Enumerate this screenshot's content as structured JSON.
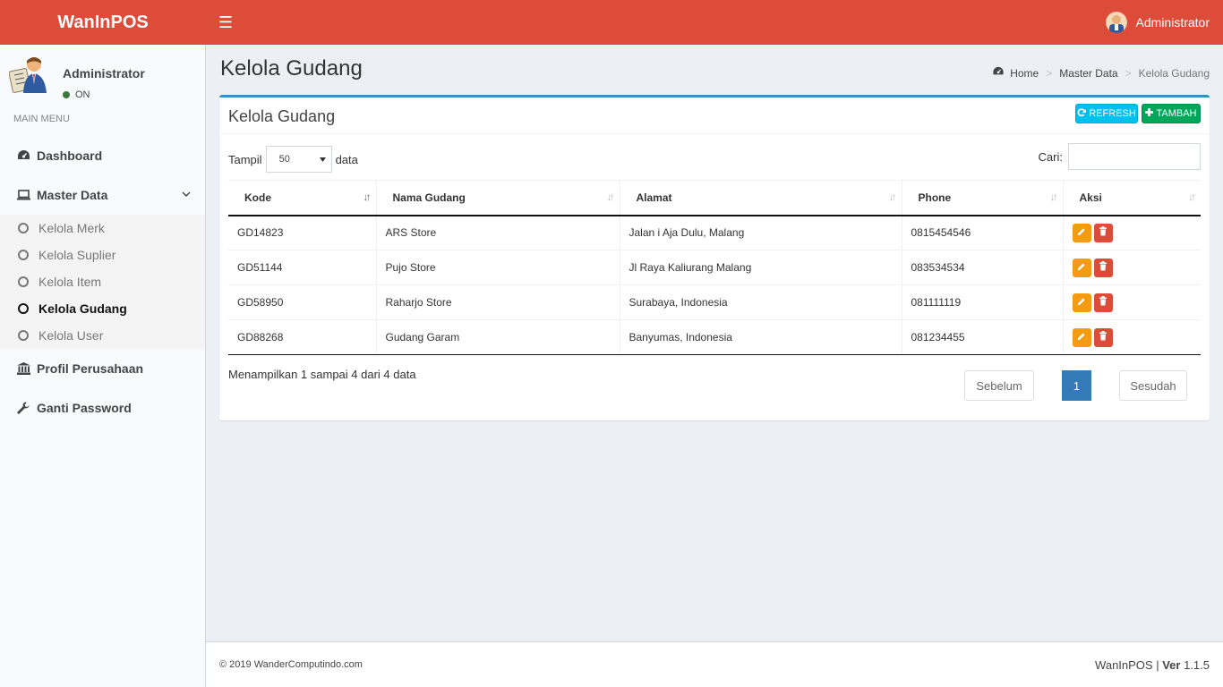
{
  "app": {
    "logo": "WanInPOS"
  },
  "topbar": {
    "menu_icon": "hamburger-icon",
    "user_name": "Administrator"
  },
  "sidebar": {
    "user_name": "Administrator",
    "user_status": "ON",
    "menu_header": "MAIN MENU",
    "items": [
      {
        "label": "Dashboard",
        "icon": "dashboard-icon"
      },
      {
        "label": "Master Data",
        "icon": "laptop-icon"
      },
      {
        "label": "Profil Perusahaan",
        "icon": "bank-icon"
      },
      {
        "label": "Ganti Password",
        "icon": "wrench-icon"
      }
    ],
    "submenu": [
      {
        "label": "Kelola Merk"
      },
      {
        "label": "Kelola Suplier"
      },
      {
        "label": "Kelola Item"
      },
      {
        "label": "Kelola Gudang"
      },
      {
        "label": "Kelola User"
      }
    ]
  },
  "page": {
    "title": "Kelola Gudang",
    "breadcrumb": {
      "home": "Home",
      "section": "Master Data",
      "current": "Kelola Gudang"
    }
  },
  "box": {
    "title": "Kelola Gudang",
    "refresh_label": "REFRESH",
    "add_label": "TAMBAH",
    "show_prefix": "Tampil",
    "show_value": "50",
    "show_suffix": "data",
    "search_label": "Cari:",
    "search_value": ""
  },
  "table": {
    "headers": [
      "Kode",
      "Nama Gudang",
      "Alamat",
      "Phone",
      "Aksi"
    ],
    "rows": [
      {
        "kode": "GD14823",
        "nama": "ARS Store",
        "alamat": "Jalan i Aja Dulu, Malang",
        "phone": "0815454546"
      },
      {
        "kode": "GD51144",
        "nama": "Pujo Store",
        "alamat": "Jl Raya Kaliurang Malang",
        "phone": "083534534"
      },
      {
        "kode": "GD58950",
        "nama": "Raharjo Store",
        "alamat": "Surabaya, Indonesia",
        "phone": "081111119"
      },
      {
        "kode": "GD88268",
        "nama": "Gudang Garam",
        "alamat": "Banyumas, Indonesia",
        "phone": "081234455"
      }
    ]
  },
  "pagination": {
    "info": "Menampilkan 1 sampai 4 dari 4 data",
    "prev": "Sebelum",
    "current": "1",
    "next": "Sesudah"
  },
  "footer": {
    "copyright": "© 2019  WanderComputindo.com",
    "app_name": "WanInPOS",
    "version_label": "Ver",
    "version": "1.1.5"
  },
  "colors": {
    "header": "#dd4b39",
    "primary": "#3c8dbc",
    "info": "#00c0ef",
    "success": "#00a65a",
    "warning": "#f39c12",
    "danger": "#dd4b39"
  }
}
